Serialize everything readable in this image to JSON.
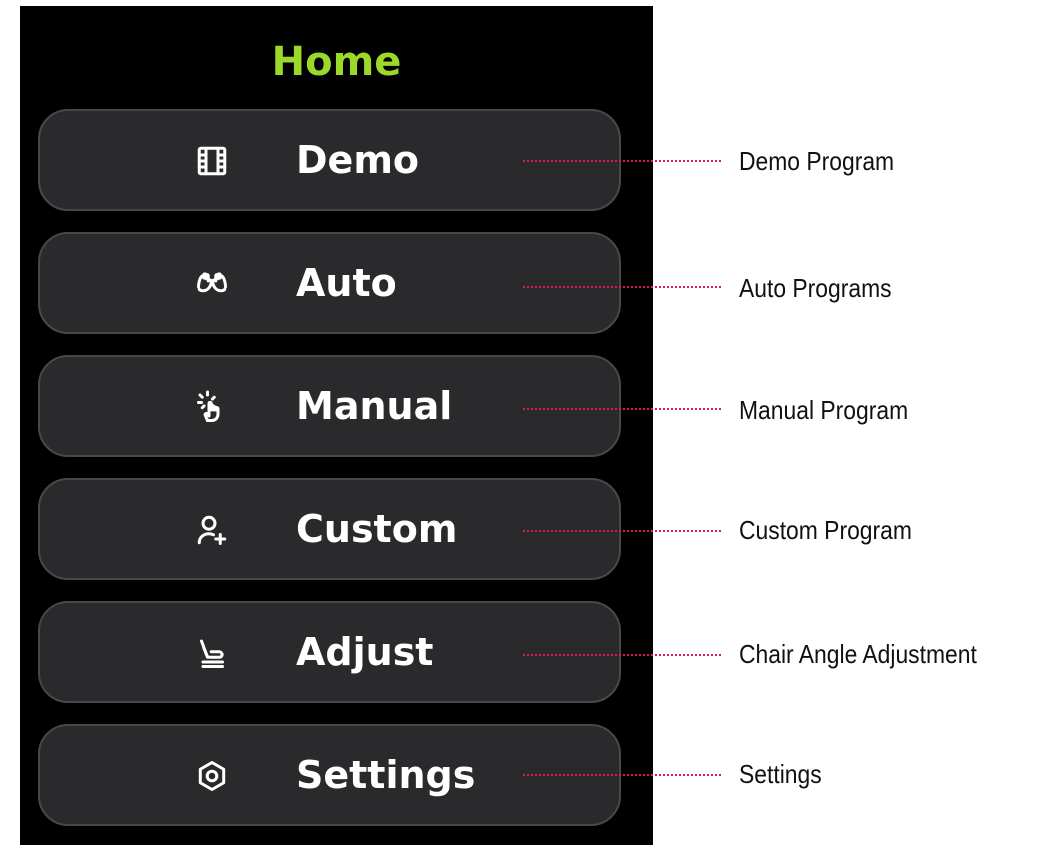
{
  "screen": {
    "title": "Home",
    "title_color": "#9bd82a",
    "background": "#000000"
  },
  "menu": [
    {
      "label": "Demo",
      "icon": "film-icon",
      "callout": "Demo Program"
    },
    {
      "label": "Auto",
      "icon": "massage-hands-icon",
      "callout": "Auto Programs"
    },
    {
      "label": "Manual",
      "icon": "tap-hand-icon",
      "callout": "Manual Program"
    },
    {
      "label": "Custom",
      "icon": "user-add-icon",
      "callout": "Custom Program"
    },
    {
      "label": "Adjust",
      "icon": "seat-icon",
      "callout": "Chair Angle Adjustment"
    },
    {
      "label": "Settings",
      "icon": "settings-hexagon-icon",
      "callout": "Settings"
    }
  ],
  "colors": {
    "button_fill": "#2a2a2c",
    "button_border": "#48484b",
    "leader_line": "#d81b55",
    "label": "#ffffff"
  }
}
